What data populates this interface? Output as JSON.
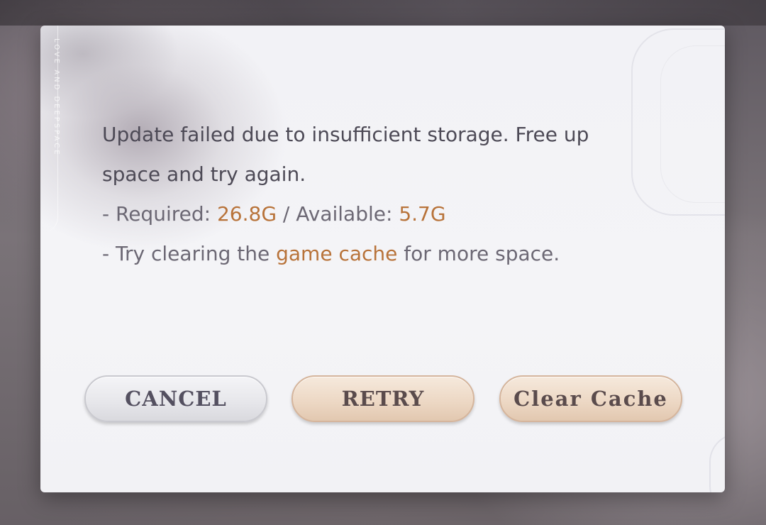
{
  "dialog": {
    "brand_watermark": "LOVE AND DEEPSPACE",
    "message": {
      "line1": "Update failed due to insufficient storage. Free up",
      "line2": "space and try again.",
      "required_label": "- Required: ",
      "required_value": "26.8G",
      "separator": " / Available: ",
      "available_value": "5.7G",
      "tip_prefix": "- Try clearing the ",
      "tip_highlight": "game cache",
      "tip_suffix": " for more space."
    },
    "buttons": {
      "cancel_label": "CANCEL",
      "retry_label": "RETRY",
      "clear_cache_label": "Clear Cache"
    }
  },
  "colors": {
    "highlight": "#b8733a",
    "text_main": "#4d4a56",
    "button_warm": "#ecd7c3",
    "button_neutral": "#e6e6ea"
  }
}
